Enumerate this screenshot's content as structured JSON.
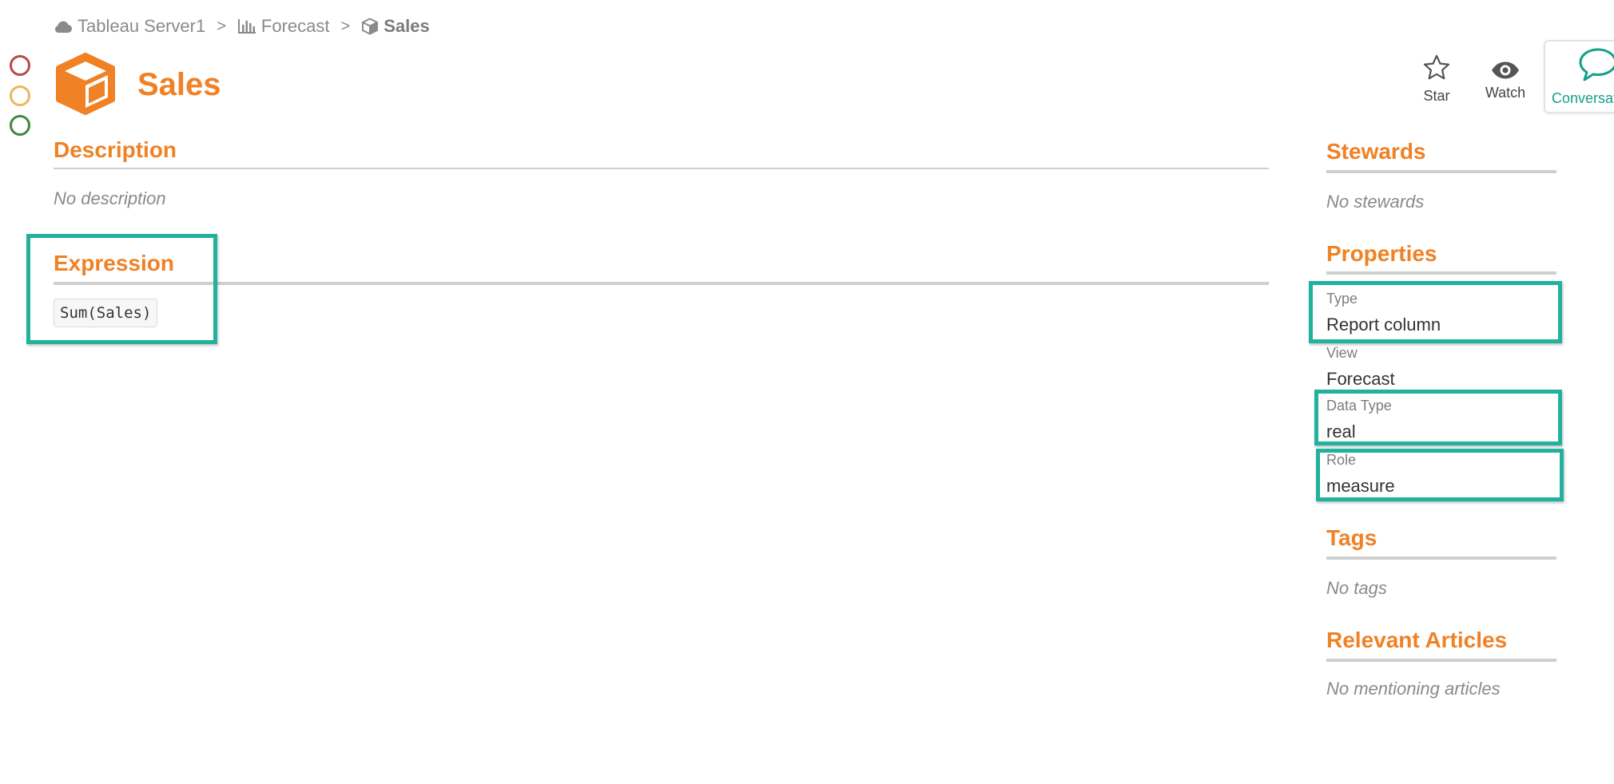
{
  "status": {
    "red": "#b94a48",
    "yellow": "#efb560",
    "green": "#3e8840"
  },
  "breadcrumb": {
    "items": [
      {
        "label": "Tableau Server1",
        "icon": "cloud-icon"
      },
      {
        "label": "Forecast",
        "icon": "bar-chart-icon"
      },
      {
        "label": "Sales",
        "icon": "cube-icon"
      }
    ],
    "separator": ">"
  },
  "header": {
    "title": "Sales",
    "icon": "cube-icon",
    "accent": "#f08124"
  },
  "actions": {
    "star": {
      "label": "Star",
      "icon": "star-icon"
    },
    "watch": {
      "label": "Watch",
      "icon": "eye-icon"
    },
    "conversation": {
      "label": "Conversation",
      "icon": "speech-bubble-icon",
      "color": "#14a089"
    }
  },
  "main": {
    "description": {
      "title": "Description",
      "empty": "No description"
    },
    "expression": {
      "title": "Expression",
      "code": "Sum(Sales)"
    }
  },
  "sidebar": {
    "stewards": {
      "title": "Stewards",
      "empty": "No stewards"
    },
    "properties": {
      "title": "Properties",
      "items": [
        {
          "label": "Type",
          "value": "Report column"
        },
        {
          "label": "View",
          "value": "Forecast"
        },
        {
          "label": "Data Type",
          "value": "real"
        },
        {
          "label": "Role",
          "value": "measure"
        }
      ]
    },
    "tags": {
      "title": "Tags",
      "empty": "No tags"
    },
    "articles": {
      "title": "Relevant Articles",
      "empty": "No mentioning articles"
    }
  },
  "highlight_color": "#22b19c"
}
